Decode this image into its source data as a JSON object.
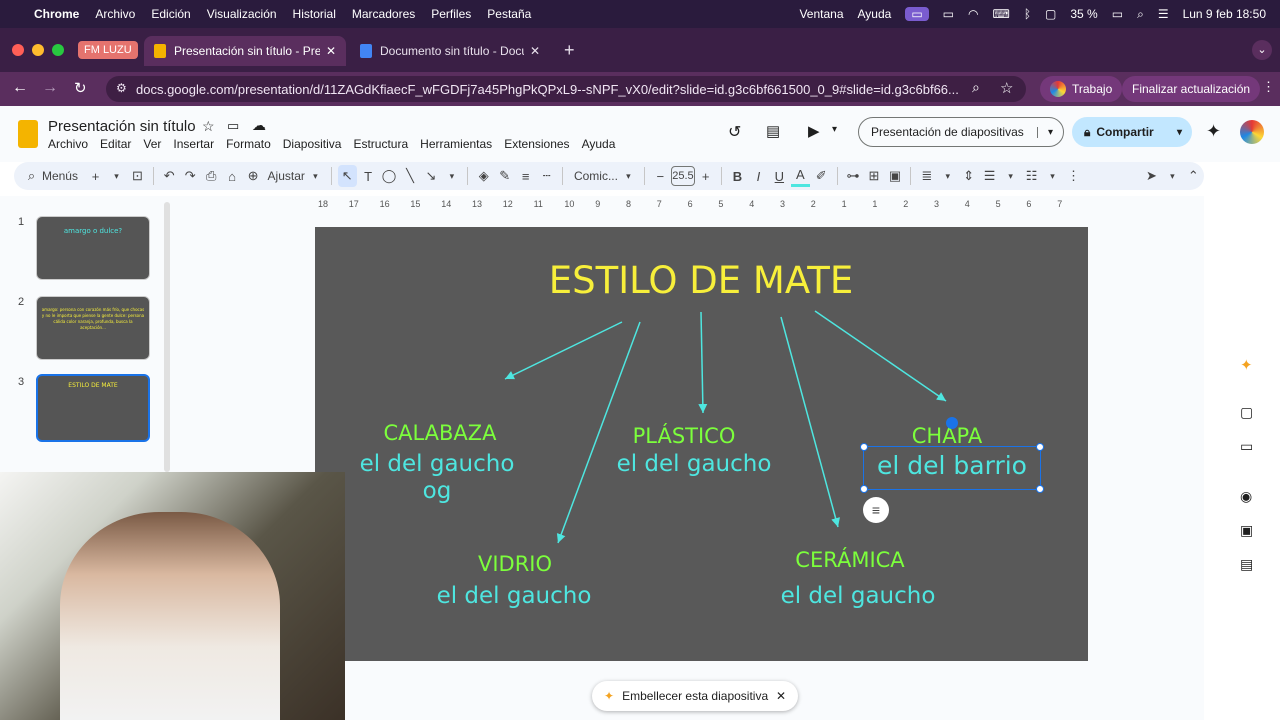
{
  "menubar": {
    "app": "Chrome",
    "items": [
      "Archivo",
      "Edición",
      "Visualización",
      "Historial",
      "Marcadores",
      "Perfiles",
      "Pestaña"
    ],
    "right": [
      "Ventana",
      "Ayuda"
    ],
    "battery": "35 %",
    "datetime": "Lun 9 feb 18:50"
  },
  "tabs": {
    "group": "FM LUZU",
    "tab1": "Presentación sin título - Prese",
    "tab2": "Documento sin título - Docum"
  },
  "address": {
    "url": "docs.google.com/presentation/d/11ZAGdKfiaecF_wFGDFj7a45PhgPkQPxL9--sNPF_vX0/edit?slide=id.g3c6bf661500_0_9#slide=id.g3c6bf66...",
    "profile": "Trabajo",
    "update": "Finalizar actualización"
  },
  "doc": {
    "title": "Presentación sin título",
    "menus": [
      "Archivo",
      "Editar",
      "Ver",
      "Insertar",
      "Formato",
      "Diapositiva",
      "Estructura",
      "Herramientas",
      "Extensiones",
      "Ayuda"
    ],
    "present": "Presentación de diapositivas",
    "share": "Compartir"
  },
  "toolbar": {
    "menus": "Menús",
    "zoom": "Ajustar",
    "font": "Comic...",
    "size": "25.5"
  },
  "ruler": [
    "18",
    "17",
    "16",
    "15",
    "14",
    "13",
    "12",
    "11",
    "10",
    "9",
    "8",
    "7",
    "6",
    "5",
    "4",
    "3",
    "2",
    "1",
    "1",
    "2",
    "3",
    "4",
    "5",
    "6",
    "7"
  ],
  "filmstrip": [
    {
      "n": "1",
      "text": "amargo o dulce?"
    },
    {
      "n": "2",
      "text": "amargo: persona con corazón más frío, que chocas y no le importa que piense la gente  dulce: persona cálida color naranja, profunda, busca la aceptación..."
    },
    {
      "n": "3",
      "text": "ESTILO DE MATE"
    }
  ],
  "slide": {
    "title": "ESTILO DE MATE",
    "items": [
      {
        "name": "CALABAZA",
        "desc": "el del gaucho",
        "extra": "og"
      },
      {
        "name": "PLÁSTICO",
        "desc": "el del gaucho"
      },
      {
        "name": "CHAPA",
        "desc": "el del barrio"
      },
      {
        "name": "VIDRIO",
        "desc": "el del gaucho"
      },
      {
        "name": "CERÁMICA",
        "desc": "el del gaucho"
      }
    ]
  },
  "colors": {
    "title": "#f7ef3b",
    "green": "#7CFF3C",
    "cyan": "#4ee6e0",
    "slide_bg": "#595959"
  },
  "footer": {
    "beautify": "Embellecer esta diapositiva"
  }
}
